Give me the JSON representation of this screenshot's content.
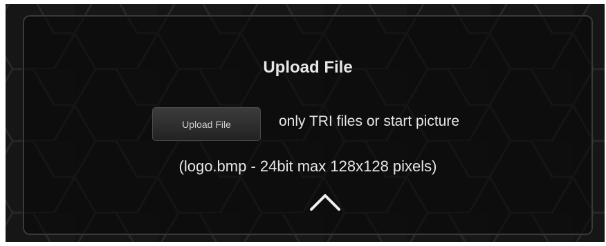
{
  "panel": {
    "title": "Upload File",
    "upload_button_label": "Upload File",
    "hint_text": "only TRI files or start picture",
    "format_note": "(logo.bmp - 24bit max 128x128 pixels)",
    "collapse_icon": "chevron-up-icon"
  },
  "colors": {
    "background": "#141414",
    "text": "#e6e6e6",
    "button": "#2e2e2e"
  }
}
